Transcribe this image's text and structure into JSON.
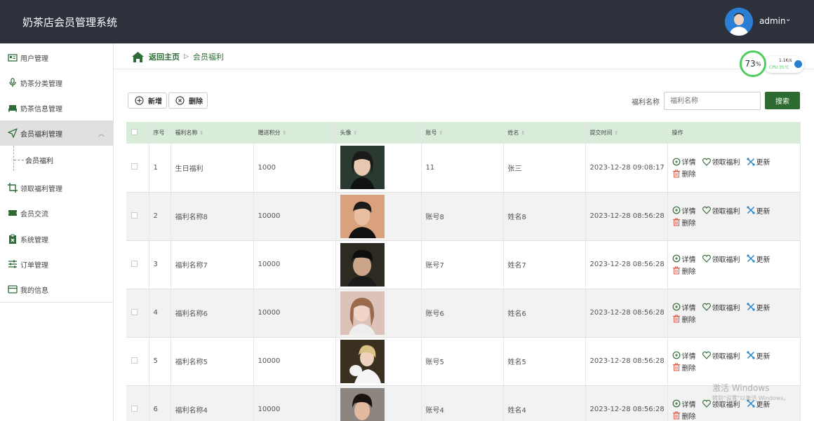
{
  "header": {
    "title": "奶茶店会员管理系统",
    "user": "admin",
    "user_caret": "⌄"
  },
  "sidebar": {
    "items": [
      {
        "label": "用户管理",
        "icon": "user-card-icon"
      },
      {
        "label": "奶茶分类管理",
        "icon": "microphone-icon"
      },
      {
        "label": "奶茶信息管理",
        "icon": "sofa-icon"
      },
      {
        "label": "会员福利管理",
        "icon": "navigation-arrow-icon"
      },
      {
        "label": "领取福利管理",
        "icon": "crop-icon"
      },
      {
        "label": "会员交流",
        "icon": "ticket-icon"
      },
      {
        "label": "系统管理",
        "icon": "clipboard-icon"
      },
      {
        "label": "订单管理",
        "icon": "sliders-icon"
      },
      {
        "label": "我的信息",
        "icon": "wallet-card-icon"
      }
    ],
    "active_caret": "︿",
    "sub_item": "会员福利"
  },
  "breadcrumb": {
    "home": "返回主页",
    "separator": "▷",
    "current": "会员福利"
  },
  "cpu": {
    "percent": "73",
    "percent_unit": "%",
    "speed": "1.1K/s",
    "temp": "CPU 35℃"
  },
  "toolbar": {
    "add": "新增",
    "delete": "删除",
    "search_label": "福利名称",
    "search_placeholder": "福利名称",
    "search_button": "搜索"
  },
  "table": {
    "headers": [
      "",
      "序号",
      "福利名称",
      "赠送积分",
      "头像",
      "账号",
      "姓名",
      "提交时间",
      "操作"
    ],
    "sort_icon": "⇕",
    "rows": [
      {
        "index": "1",
        "name": "生日福利",
        "points": "1000",
        "account": "11",
        "person": "张三",
        "time": "2023-12-28 09:08:17"
      },
      {
        "index": "2",
        "name": "福利名称8",
        "points": "10000",
        "account": "账号8",
        "person": "姓名8",
        "time": "2023-12-28 08:56:28"
      },
      {
        "index": "3",
        "name": "福利名称7",
        "points": "10000",
        "account": "账号7",
        "person": "姓名7",
        "time": "2023-12-28 08:56:28"
      },
      {
        "index": "4",
        "name": "福利名称6",
        "points": "10000",
        "account": "账号6",
        "person": "姓名6",
        "time": "2023-12-28 08:56:28"
      },
      {
        "index": "5",
        "name": "福利名称5",
        "points": "10000",
        "account": "账号5",
        "person": "姓名5",
        "time": "2023-12-28 08:56:28"
      },
      {
        "index": "6",
        "name": "福利名称4",
        "points": "10000",
        "account": "账号4",
        "person": "姓名4",
        "time": "2023-12-28 08:56:28"
      }
    ],
    "ops": {
      "detail": "详情",
      "claim": "领取福利",
      "update": "更新",
      "delete": "删除"
    }
  },
  "watermark": {
    "line1": "激活 Windows",
    "line2": "转到\"设置\"以激活 Windows。"
  },
  "colors": {
    "header_bg": "#2c313b",
    "accent": "#2e6b30",
    "table_header_bg": "#d9ebd9",
    "cpu_ring": "#4ccd5c"
  }
}
